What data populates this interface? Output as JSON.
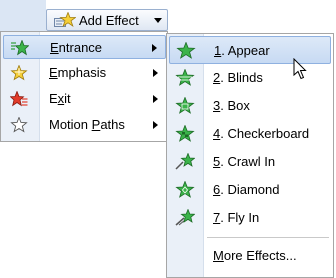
{
  "toolbar": {
    "add_effect_label": "Add Effect",
    "add_effect_icon": "star-add-icon"
  },
  "effect_menu": {
    "items": [
      {
        "label_u": "E",
        "label_rest": "ntrance",
        "icon": "green-star-icon",
        "has_submenu": true,
        "highlighted": true
      },
      {
        "label_u": "E",
        "label_rest": "mphasis",
        "icon": "yellow-star-icon",
        "has_submenu": true,
        "highlighted": false
      },
      {
        "label_pre": "E",
        "label_u": "x",
        "label_rest": "it",
        "icon": "red-star-icon",
        "has_submenu": true,
        "highlighted": false
      },
      {
        "label_pre": "Motion ",
        "label_u": "P",
        "label_rest": "aths",
        "icon": "outline-star-icon",
        "has_submenu": true,
        "highlighted": false
      }
    ]
  },
  "entrance_submenu": {
    "items": [
      {
        "num": "1",
        "label": ". Appear",
        "highlighted": true
      },
      {
        "num": "2",
        "label": ". Blinds",
        "highlighted": false
      },
      {
        "num": "3",
        "label": ". Box",
        "highlighted": false
      },
      {
        "num": "4",
        "label": ". Checkerboard",
        "highlighted": false
      },
      {
        "num": "5",
        "label": ". Crawl In",
        "highlighted": false
      },
      {
        "num": "6",
        "label": ". Diamond",
        "highlighted": false
      },
      {
        "num": "7",
        "label": ". Fly In",
        "highlighted": false
      }
    ],
    "more_u": "M",
    "more_rest": "ore Effects..."
  },
  "colors": {
    "menu_highlight": "#c7daf3",
    "menu_highlight_border": "#8fb1e0",
    "green_star": "#2f9e3a",
    "yellow_star": "#f2c82f",
    "red_star": "#e23b2a"
  }
}
